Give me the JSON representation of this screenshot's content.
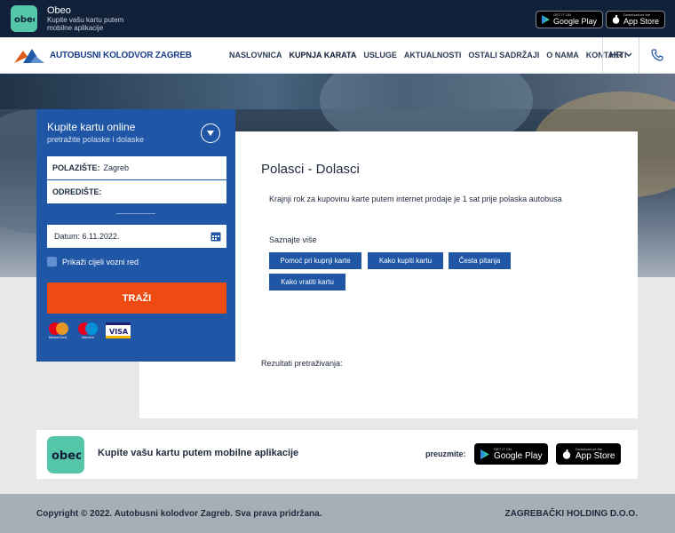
{
  "topbar": {
    "app_name": "Obeo",
    "app_tagline": "Kupite vašu kartu putem mobilne aplikacije",
    "google_play_small": "GET IT ON",
    "google_play": "Google Play",
    "app_store_small": "Download on the",
    "app_store": "App Store"
  },
  "navbar": {
    "brand": "AUTOBUSNI KOLODVOR ZAGREB",
    "items": [
      "NASLOVNICA",
      "KUPNJA KARATA",
      "USLUGE",
      "AKTUALNOSTI",
      "OSTALI SADRŽAJI",
      "O NAMA",
      "KONTAKTI"
    ],
    "active_item": "KUPNJA KARATA",
    "language": "HR"
  },
  "search": {
    "title": "Kupite kartu online",
    "subtitle": "pretražite polaske i dolaske",
    "from_label": "POLAZIŠTE:",
    "from_value": "Zagreb",
    "to_label": "ODREDIŠTE:",
    "to_value": "",
    "date_label": "Datum:",
    "date_value": "6.11.2022.",
    "show_timetable": "Prikaži cijeli vozni red",
    "search_button": "TRAŽI",
    "payment_icons": [
      "mastercard-icon",
      "maestro-icon",
      "visa-icon"
    ],
    "payment_labels": [
      "MasterCard",
      "Maestro",
      "VISA"
    ]
  },
  "content": {
    "title": "Polasci - Dolasci",
    "note": "Krajnji rok za kupovinu karte putem internet prodaje je 1 sat prije polaska autobusa",
    "learn_more": "Saznajte više",
    "buttons": [
      "Pomoć pri kupnji karte",
      "Kako kupiti kartu",
      "Česta pitanja",
      "Kako vratiti kartu"
    ],
    "results_label": "Rezultati pretraživanja:"
  },
  "app_banner": {
    "text": "Kupite vašu kartu putem mobilne aplikacije",
    "download_label": "preuzmite:",
    "google_play_small": "GET IT ON",
    "google_play": "Google Play",
    "app_store_small": "Download on the",
    "app_store": "App Store"
  },
  "footer": {
    "copyright": "Copyright © 2022. Autobusni kolodvor Zagreb. Sva prava pridržana.",
    "holding": "ZAGREBAČKI HOLDING D.O.O."
  },
  "colors": {
    "primary_blue": "#1f56a6",
    "accent_orange": "#ee4b12",
    "topbar_navy": "#12213a",
    "app_green": "#56c6a9"
  }
}
